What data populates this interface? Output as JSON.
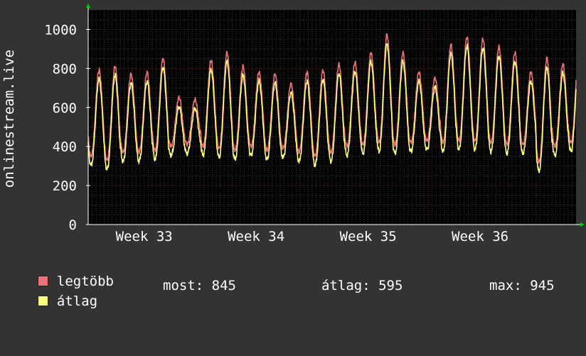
{
  "colors": {
    "background": "#333333",
    "plot_background": "#000000",
    "grid_minor": "#3a3a3a",
    "grid_major": "#6b2020",
    "axis": "#ffffff",
    "arrow": "#00cc00",
    "series_max": "#f07178",
    "series_avg": "#ffff80"
  },
  "chart_data": {
    "type": "line",
    "title": "",
    "xlabel": "",
    "ylabel": "onlinestream.live",
    "ylim": [
      0,
      1100
    ],
    "yticks": [
      0,
      200,
      400,
      600,
      800,
      1000
    ],
    "x_tick_labels": [
      "Week 33",
      "Week 34",
      "Week 35",
      "Week 36"
    ],
    "x_range_days": [
      0,
      30.5
    ],
    "x_tick_positions_days": [
      3.5,
      10.5,
      17.5,
      24.5
    ],
    "grid": true,
    "daily_extremes": {
      "peak": [
        770,
        790,
        750,
        760,
        830,
        630,
        620,
        820,
        860,
        790,
        760,
        750,
        700,
        760,
        770,
        800,
        810,
        860,
        950,
        860,
        760,
        730,
        900,
        940,
        930,
        890,
        860,
        760,
        830,
        800,
        860
      ],
      "trough": [
        330,
        310,
        350,
        350,
        360,
        380,
        390,
        380,
        370,
        360,
        380,
        360,
        370,
        350,
        330,
        350,
        380,
        390,
        400,
        390,
        400,
        410,
        400,
        410,
        410,
        400,
        390,
        390,
        300,
        380,
        400
      ]
    },
    "series": [
      {
        "name": "legtöbb",
        "color": "#f07178"
      },
      {
        "name": "átlag",
        "color": "#ffff80"
      }
    ]
  },
  "legend": {
    "max_label": "legtöbb",
    "avg_label": "átlag",
    "now_stat": "most: 845",
    "avg_stat": "átlag: 595",
    "max_stat": "max: 945"
  }
}
